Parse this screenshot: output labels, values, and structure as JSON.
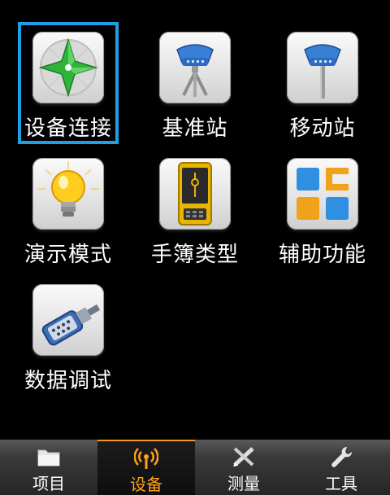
{
  "grid": {
    "items": [
      {
        "label": "设备连接",
        "icon": "compass-icon",
        "selected": true
      },
      {
        "label": "基准站",
        "icon": "base-station-tripod-icon",
        "selected": false
      },
      {
        "label": "移动站",
        "icon": "rover-pole-icon",
        "selected": false
      },
      {
        "label": "演示模式",
        "icon": "lightbulb-icon",
        "selected": false
      },
      {
        "label": "手簿类型",
        "icon": "handheld-controller-icon",
        "selected": false
      },
      {
        "label": "辅助功能",
        "icon": "tiles-icon",
        "selected": false
      },
      {
        "label": "数据调试",
        "icon": "serial-connector-icon",
        "selected": false
      }
    ]
  },
  "tabbar": {
    "tabs": [
      {
        "label": "项目",
        "icon": "folder-icon",
        "active": false
      },
      {
        "label": "设备",
        "icon": "antenna-icon",
        "active": true
      },
      {
        "label": "测量",
        "icon": "survey-pencil-icon",
        "active": false
      },
      {
        "label": "工具",
        "icon": "wrench-icon",
        "active": false
      }
    ]
  },
  "colors": {
    "selection": "#1f9fe6",
    "active_tab": "#ffa21b",
    "background": "#000000"
  }
}
